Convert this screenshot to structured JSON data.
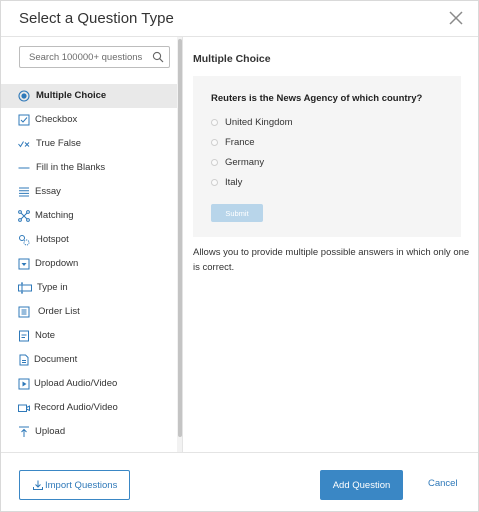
{
  "dialog": {
    "title": "Select a Question Type"
  },
  "search": {
    "placeholder": "Search 100000+ questions"
  },
  "sidebar": {
    "items": [
      {
        "label": "Multiple Choice",
        "icon": "radio-selected-icon",
        "active": true
      },
      {
        "label": "Checkbox",
        "icon": "checkbox-icon"
      },
      {
        "label": "True False",
        "icon": "true-false-icon"
      },
      {
        "label": "Fill in the Blanks",
        "icon": "blank-line-icon"
      },
      {
        "label": "Essay",
        "icon": "lines-icon"
      },
      {
        "label": "Matching",
        "icon": "matching-icon"
      },
      {
        "label": "Hotspot",
        "icon": "hotspot-icon"
      },
      {
        "label": "Dropdown",
        "icon": "dropdown-icon"
      },
      {
        "label": "Type in",
        "icon": "type-in-icon"
      },
      {
        "label": "Order List",
        "icon": "order-list-icon"
      },
      {
        "label": "Note",
        "icon": "note-icon"
      },
      {
        "label": "Document",
        "icon": "document-icon"
      },
      {
        "label": "Upload Audio/Video",
        "icon": "play-icon"
      },
      {
        "label": "Record Audio/Video",
        "icon": "record-video-icon"
      },
      {
        "label": "Upload",
        "icon": "upload-icon"
      }
    ]
  },
  "main": {
    "title": "Multiple Choice",
    "preview": {
      "question": "Reuters is the News Agency of which country?",
      "options": [
        "United Kingdom",
        "France",
        "Germany",
        "Italy"
      ],
      "submit_label": "Submit"
    },
    "description": "Allows you to provide multiple possible answers in which only one is correct."
  },
  "footer": {
    "import_label": "Import Questions",
    "add_label": "Add Question",
    "cancel_label": "Cancel"
  },
  "colors": {
    "accent": "#3a87c5",
    "accent_light": "#b8d5ea",
    "active_row": "#e9e9e9",
    "preview_bg": "#f5f5f5"
  }
}
